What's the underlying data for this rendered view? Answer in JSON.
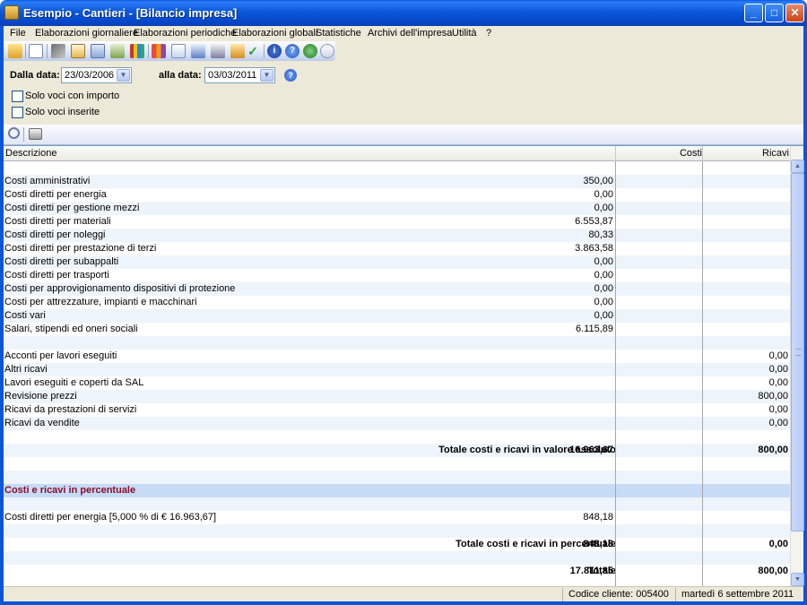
{
  "window": {
    "title": "Esempio - Cantieri - [Bilancio impresa]",
    "min": "_",
    "max": "□",
    "close": "✕"
  },
  "menu": [
    "File",
    "Elaborazioni giornaliere",
    "Elaborazioni periodiche",
    "Elaborazioni globali",
    "Statistiche",
    "Archivi dell'impresa",
    "Utilità",
    "?"
  ],
  "filters": {
    "from_label": "Dalla data:",
    "from_value": "23/03/2006",
    "to_label": "alla data:",
    "to_value": "03/03/2011",
    "help": "?",
    "check1": "Solo voci con importo",
    "check2": "Solo voci inserite"
  },
  "grid": {
    "headers": {
      "descr": "Descrizione",
      "costi": "Costi",
      "ricavi": "Ricavi"
    },
    "rows": [
      {
        "d": "",
        "c": "",
        "r": "",
        "t": "blank"
      },
      {
        "d": "Costi amministrativi",
        "c": "350,00",
        "r": ""
      },
      {
        "d": "Costi diretti per energia",
        "c": "0,00",
        "r": ""
      },
      {
        "d": "Costi diretti per gestione mezzi",
        "c": "0,00",
        "r": ""
      },
      {
        "d": "Costi diretti per materiali",
        "c": "6.553,87",
        "r": ""
      },
      {
        "d": "Costi diretti per noleggi",
        "c": "80,33",
        "r": ""
      },
      {
        "d": "Costi diretti per prestazione di terzi",
        "c": "3.863,58",
        "r": ""
      },
      {
        "d": "Costi diretti per subappalti",
        "c": "0,00",
        "r": ""
      },
      {
        "d": "Costi diretti per trasporti",
        "c": "0,00",
        "r": ""
      },
      {
        "d": "Costi per approvigionamento dispositivi di protezione",
        "c": "0,00",
        "r": ""
      },
      {
        "d": "Costi per attrezzature, impianti e macchinari",
        "c": "0,00",
        "r": ""
      },
      {
        "d": "Costi vari",
        "c": "0,00",
        "r": ""
      },
      {
        "d": "Salari, stipendi ed oneri sociali",
        "c": "6.115,89",
        "r": ""
      },
      {
        "d": "",
        "c": "",
        "r": "",
        "t": "blank"
      },
      {
        "d": "Acconti per lavori eseguiti",
        "c": "",
        "r": "0,00"
      },
      {
        "d": "Altri ricavi",
        "c": "",
        "r": "0,00"
      },
      {
        "d": "Lavori eseguiti e coperti da SAL",
        "c": "",
        "r": "0,00"
      },
      {
        "d": "Revisione prezzi",
        "c": "",
        "r": "800,00"
      },
      {
        "d": "Ricavi da prestazioni di servizi",
        "c": "",
        "r": "0,00"
      },
      {
        "d": "Ricavi da vendite",
        "c": "",
        "r": "0,00"
      },
      {
        "d": "",
        "c": "",
        "r": "",
        "t": "blank"
      },
      {
        "d": "Totale costi e ricavi in valore assoluto",
        "c": "16.963,67",
        "r": "800,00",
        "t": "total"
      },
      {
        "d": "",
        "c": "",
        "r": "",
        "t": "blank"
      },
      {
        "d": "",
        "c": "",
        "r": "",
        "t": "blank"
      },
      {
        "d": "Costi e ricavi in percentuale",
        "c": "",
        "r": "",
        "t": "section"
      },
      {
        "d": "",
        "c": "",
        "r": "",
        "t": "blank"
      },
      {
        "d": "Costi diretti per energia [5,000 % di € 16.963,67]",
        "c": "848,18",
        "r": ""
      },
      {
        "d": "",
        "c": "",
        "r": "",
        "t": "blank"
      },
      {
        "d": "Totale costi e ricavi in percentuale",
        "c": "848,18",
        "r": "0,00",
        "t": "total"
      },
      {
        "d": "",
        "c": "",
        "r": "",
        "t": "blank"
      },
      {
        "d": "Totale",
        "c": "17.811,85",
        "r": "800,00",
        "t": "total"
      }
    ]
  },
  "status": {
    "client": "Codice cliente: 005400",
    "date": "martedì 6 settembre 2011"
  },
  "icons": [
    "open-folder-icon",
    "document-icon",
    "wrench-icon",
    "edit-icon",
    "calculator-icon",
    "network-icon",
    "chart-icon",
    "bar-chart-icon",
    "report-icon",
    "cards-icon",
    "calendar-icon",
    "book-icon",
    "check-icon",
    "info-icon",
    "help-icon",
    "globe-icon",
    "mail-icon",
    "search-icon",
    "print-icon"
  ]
}
